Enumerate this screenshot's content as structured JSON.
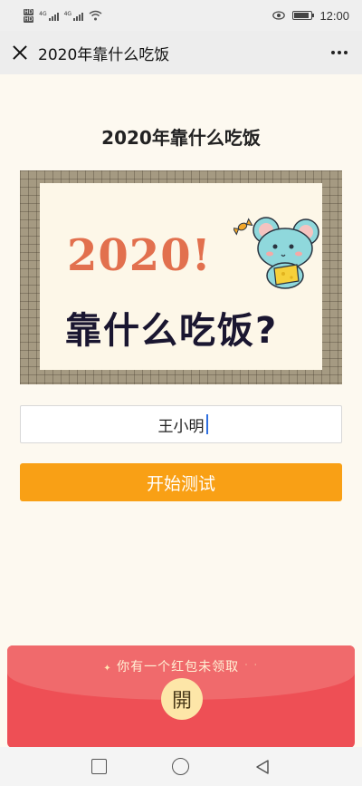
{
  "status": {
    "time": "12:00",
    "network1": "4G",
    "network2": "4G",
    "hd_labels": [
      "HD",
      "HD"
    ],
    "battery_level": 0.85
  },
  "nav": {
    "title": "2020年靠什么吃饭"
  },
  "main": {
    "heading": "2020年靠什么吃饭",
    "banner": {
      "year_text": "2020!",
      "question_text": "靠什么吃饭?"
    },
    "name_input": {
      "value": "王小明"
    },
    "start_button": {
      "label": "开始测试"
    }
  },
  "red_packet": {
    "message": "你有一个红包未领取",
    "open_label": "開"
  },
  "icons": {
    "close": "close-icon",
    "more": "more-icon",
    "wifi": "wifi-icon",
    "eye": "eye-icon",
    "battery": "battery-icon"
  }
}
